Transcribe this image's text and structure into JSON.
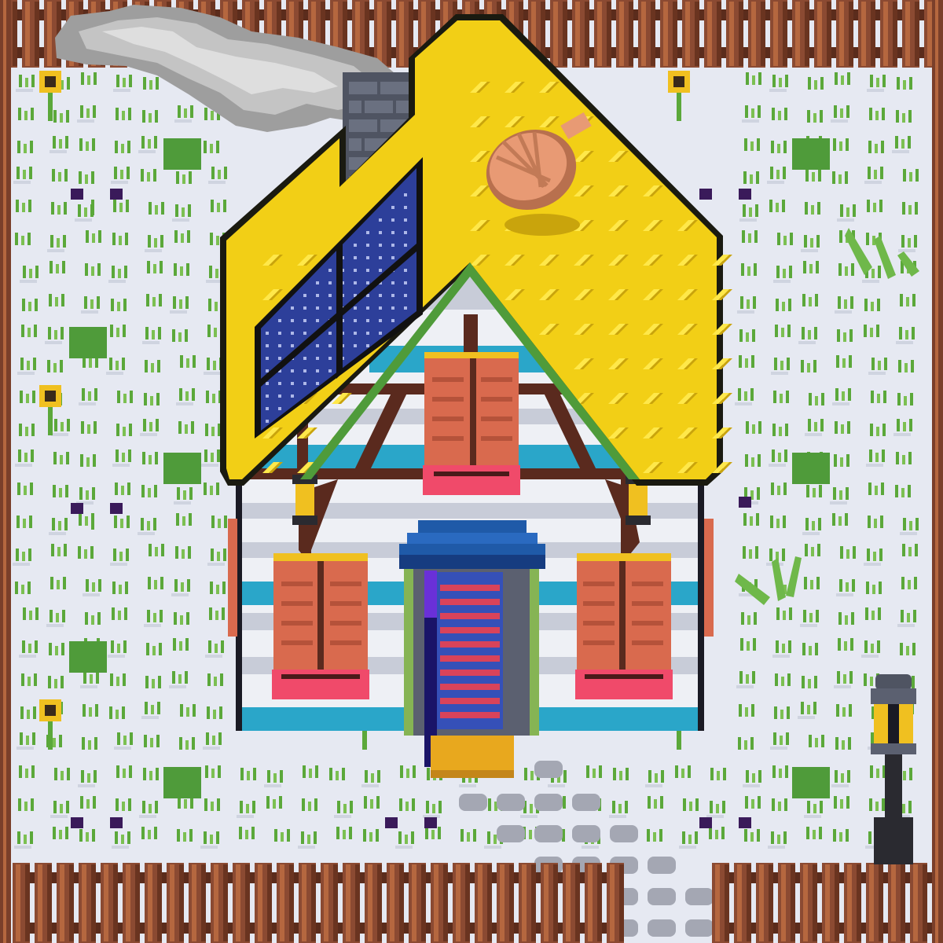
{
  "scene": {
    "name": "pixel-art-farm-house",
    "season_hint": "winter snow",
    "colors": {
      "snow": "#e6e9f2",
      "snow_shadow": "#cfd4e0",
      "fence": "#8b4a32",
      "fence_dark": "#5b2c1c",
      "fence_light": "#b5673f",
      "roof": "#f2cf16",
      "roof_dark": "#c9a40c",
      "roof_light": "#ffe84a",
      "solar_panel": "#2d3f9a",
      "wall_white": "#eef0f5",
      "wall_blue": "#2aa6c9",
      "timber": "#5a2a1e",
      "shutter": "#d96a4e",
      "flower_box": "#f04a6a",
      "awning": "#1f5aa8",
      "door_frame": "#86b454",
      "door_stripe_red": "#d9435a",
      "door_stripe_blue": "#3550b8",
      "doormat": "#e8a81e",
      "chimney": "#5b6070",
      "smoke": "#a8a8a8",
      "lamp": "#f0c020",
      "path_stone": "#a4a7b3",
      "grass": "#5ba83a"
    },
    "icons": [
      "house-icon",
      "solar-panel-icon",
      "satellite-dish-icon",
      "chimney-icon",
      "smoke-cloud-icon",
      "wall-lantern-icon",
      "street-lamp-icon",
      "sunflower-icon",
      "violet-flower-icon",
      "fence-icon",
      "stepping-stone-path-icon"
    ]
  }
}
